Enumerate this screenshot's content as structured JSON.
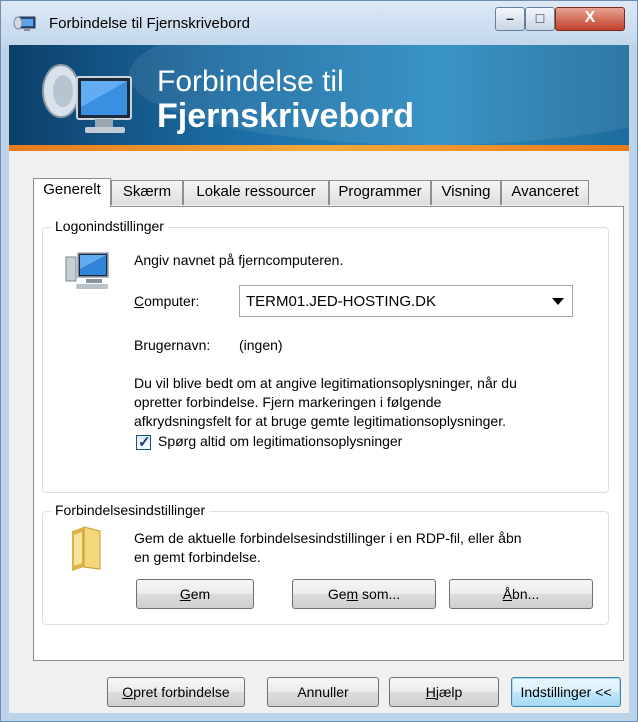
{
  "window": {
    "title": "Forbindelse til Fjernskrivebord",
    "controls": {
      "minimize": "–",
      "maximize": "□",
      "close": "X"
    }
  },
  "banner": {
    "line1": "Forbindelse til",
    "line2": "Fjernskrivebord"
  },
  "tabs": [
    {
      "label": "Generelt",
      "active": true
    },
    {
      "label": "Skærm"
    },
    {
      "label": "Lokale ressourcer"
    },
    {
      "label": "Programmer"
    },
    {
      "label": "Visning"
    },
    {
      "label": "Avanceret"
    }
  ],
  "logon": {
    "group_label": "Logonindstillinger",
    "instruction": "Angiv navnet på fjerncomputeren.",
    "computer_label": "Computer:",
    "computer_value": "TERM01.JED-HOSTING.DK",
    "username_label": "Brugernavn:",
    "username_value": "(ingen)",
    "info_line1": "Du vil blive bedt om at angive legitimationsoplysninger, når du",
    "info_line2": "opretter forbindelse. Fjern markeringen i følgende",
    "info_line3": "afkrydsningsfelt for at bruge gemte legitimationsoplysninger.",
    "checkbox_label": "Spørg altid om legitimationsoplysninger",
    "checkbox_checked": true
  },
  "connection": {
    "group_label": "Forbindelsesindstillinger",
    "text_line1": "Gem de aktuelle forbindelsesindstillinger i en RDP-fil, eller åbn",
    "text_line2": "en gemt forbindelse.",
    "save_button": "Gem",
    "save_as_button": "Gem som...",
    "open_button": "Åbn..."
  },
  "footer": {
    "connect_button": "Opret forbindelse",
    "cancel_button": "Annuller",
    "help_button": "Hjælp",
    "options_button": "Indstillinger <<"
  }
}
